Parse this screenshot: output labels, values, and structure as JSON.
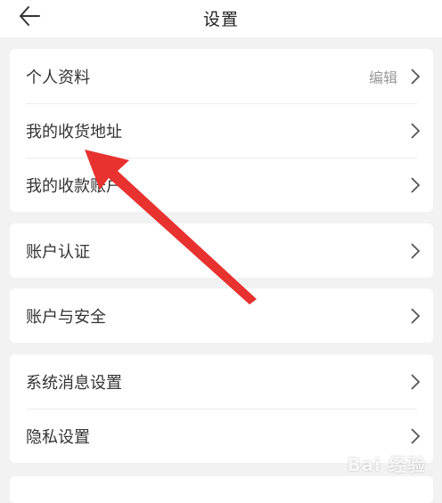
{
  "header": {
    "title": "设置",
    "back_icon": "arrow-left-icon"
  },
  "groups": [
    {
      "items": [
        {
          "label": "个人资料",
          "value": "编辑"
        },
        {
          "label": "我的收货地址",
          "value": ""
        },
        {
          "label": "我的收款账户",
          "value": ""
        }
      ]
    },
    {
      "items": [
        {
          "label": "账户认证",
          "value": ""
        }
      ]
    },
    {
      "items": [
        {
          "label": "账户与安全",
          "value": ""
        }
      ]
    },
    {
      "items": [
        {
          "label": "系统消息设置",
          "value": ""
        },
        {
          "label": "隐私设置",
          "value": ""
        }
      ]
    }
  ],
  "annotation": {
    "icon": "red-arrow-icon",
    "color": "#e8322f"
  },
  "watermark": {
    "text": "Bai 经验"
  }
}
